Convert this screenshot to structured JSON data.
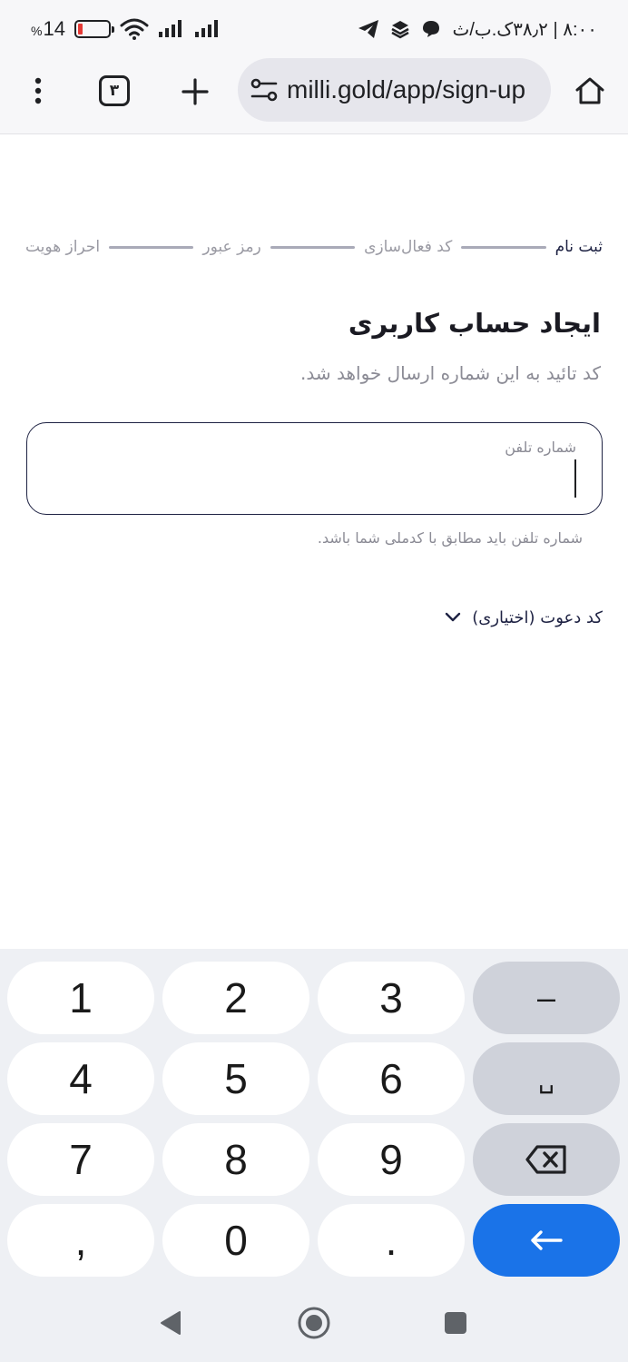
{
  "status_bar": {
    "battery_percent_sign": "%",
    "battery_level": "14",
    "clock": "۸:۰۰ | ۳۸٫۲ک.ب/ث",
    "colors": {
      "battery_low": "#e53935"
    }
  },
  "browser": {
    "tab_count": "۳",
    "url": "milli.gold/app/sign-up"
  },
  "stepper": {
    "steps": [
      {
        "label": "ثبت نام",
        "active": true
      },
      {
        "label": "کد فعال‌سازی",
        "active": false
      },
      {
        "label": "رمز عبور",
        "active": false
      },
      {
        "label": "احراز هویت",
        "active": false
      }
    ]
  },
  "signup": {
    "title": "ایجاد حساب کاربری",
    "subtitle": "کد تائید به این شماره ارسال خواهد شد.",
    "phone_label": "شماره تلفن",
    "phone_value": "",
    "phone_hint": "شماره تلفن باید مطابق با کدملی شما باشد.",
    "invite_label": "کد دعوت (اختیاری)"
  },
  "keyboard": {
    "keys": [
      "1",
      "2",
      "3",
      "–",
      "4",
      "5",
      "6",
      "␣",
      "7",
      "8",
      "9",
      "backspace",
      ",",
      "0",
      ".",
      "enter"
    ],
    "colors": {
      "enter": "#1a73e8",
      "function_key": "#cfd2da",
      "key": "#ffffff"
    }
  },
  "icons": {
    "menu": "three-dots-vertical-icon",
    "new_tab": "plus-icon",
    "site_settings": "tune-icon",
    "home": "home-icon",
    "chevron": "chevron-down-icon",
    "backspace": "backspace-icon",
    "enter": "arrow-left-icon"
  }
}
